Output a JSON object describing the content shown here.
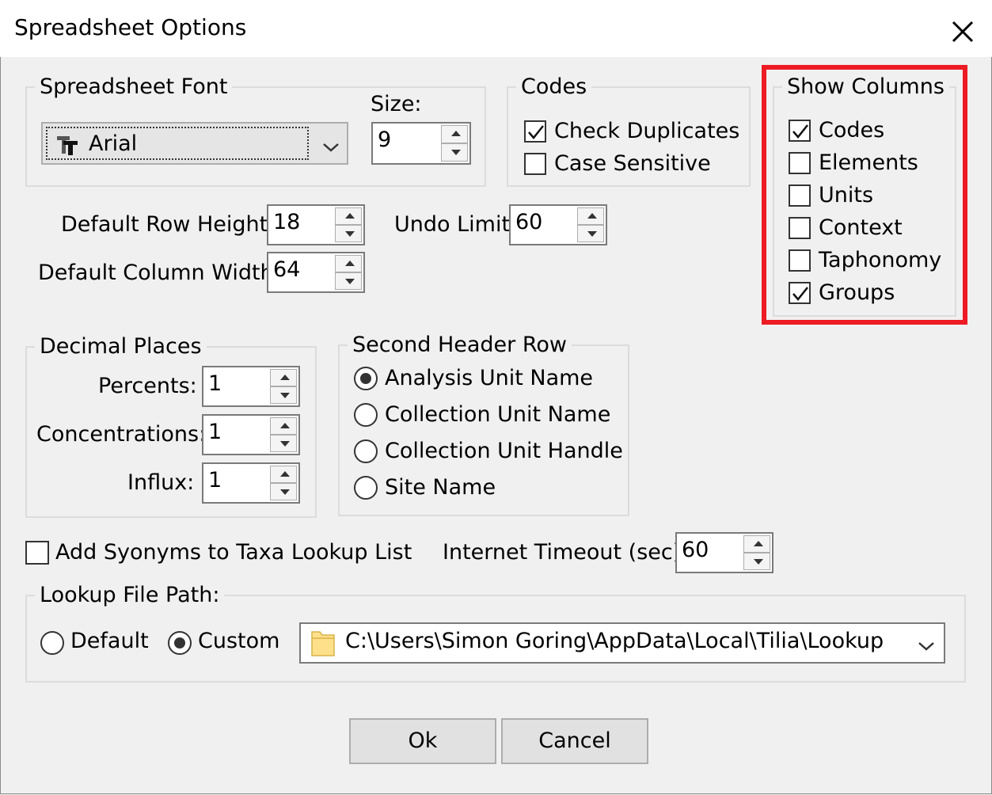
{
  "window": {
    "title": "Spreadsheet Options"
  },
  "font_group": {
    "legend": "Spreadsheet Font",
    "size_label": "Size:",
    "font_value": "Arial",
    "size_value": "9"
  },
  "codes_group": {
    "legend": "Codes",
    "check_duplicates": "Check Duplicates",
    "case_sensitive": "Case Sensitive",
    "check_duplicates_checked": true,
    "case_sensitive_checked": false
  },
  "show_columns": {
    "legend": "Show Columns",
    "items": [
      {
        "label": "Codes",
        "checked": true
      },
      {
        "label": "Elements",
        "checked": false
      },
      {
        "label": "Units",
        "checked": false
      },
      {
        "label": "Context",
        "checked": false
      },
      {
        "label": "Taphonomy",
        "checked": false
      },
      {
        "label": "Groups",
        "checked": true
      }
    ]
  },
  "row_height": {
    "label": "Default Row Height:",
    "value": "18"
  },
  "col_width": {
    "label": "Default Column Width:",
    "value": "64"
  },
  "undo": {
    "label": "Undo Limit:",
    "value": "60"
  },
  "decimal": {
    "legend": "Decimal Places",
    "percents_label": "Percents:",
    "percents": "1",
    "conc_label": "Concentrations:",
    "conc": "1",
    "influx_label": "Influx:",
    "influx": "1"
  },
  "header_row": {
    "legend": "Second Header Row",
    "options": [
      "Analysis Unit Name",
      "Collection Unit Name",
      "Collection Unit Handle",
      "Site Name"
    ],
    "selected": 0
  },
  "synonyms": {
    "label": "Add Syonyms to Taxa Lookup List",
    "checked": false
  },
  "timeout": {
    "label": "Internet Timeout (sec):",
    "value": "60"
  },
  "lookup": {
    "legend": "Lookup File Path:",
    "default_label": "Default",
    "custom_label": "Custom",
    "selected": "custom",
    "path": "C:\\Users\\Simon Goring\\AppData\\Local\\Tilia\\Lookup"
  },
  "buttons": {
    "ok": "Ok",
    "cancel": "Cancel"
  },
  "colors": {
    "highlight": "#ed1c24",
    "folder": "#ffe08a"
  }
}
